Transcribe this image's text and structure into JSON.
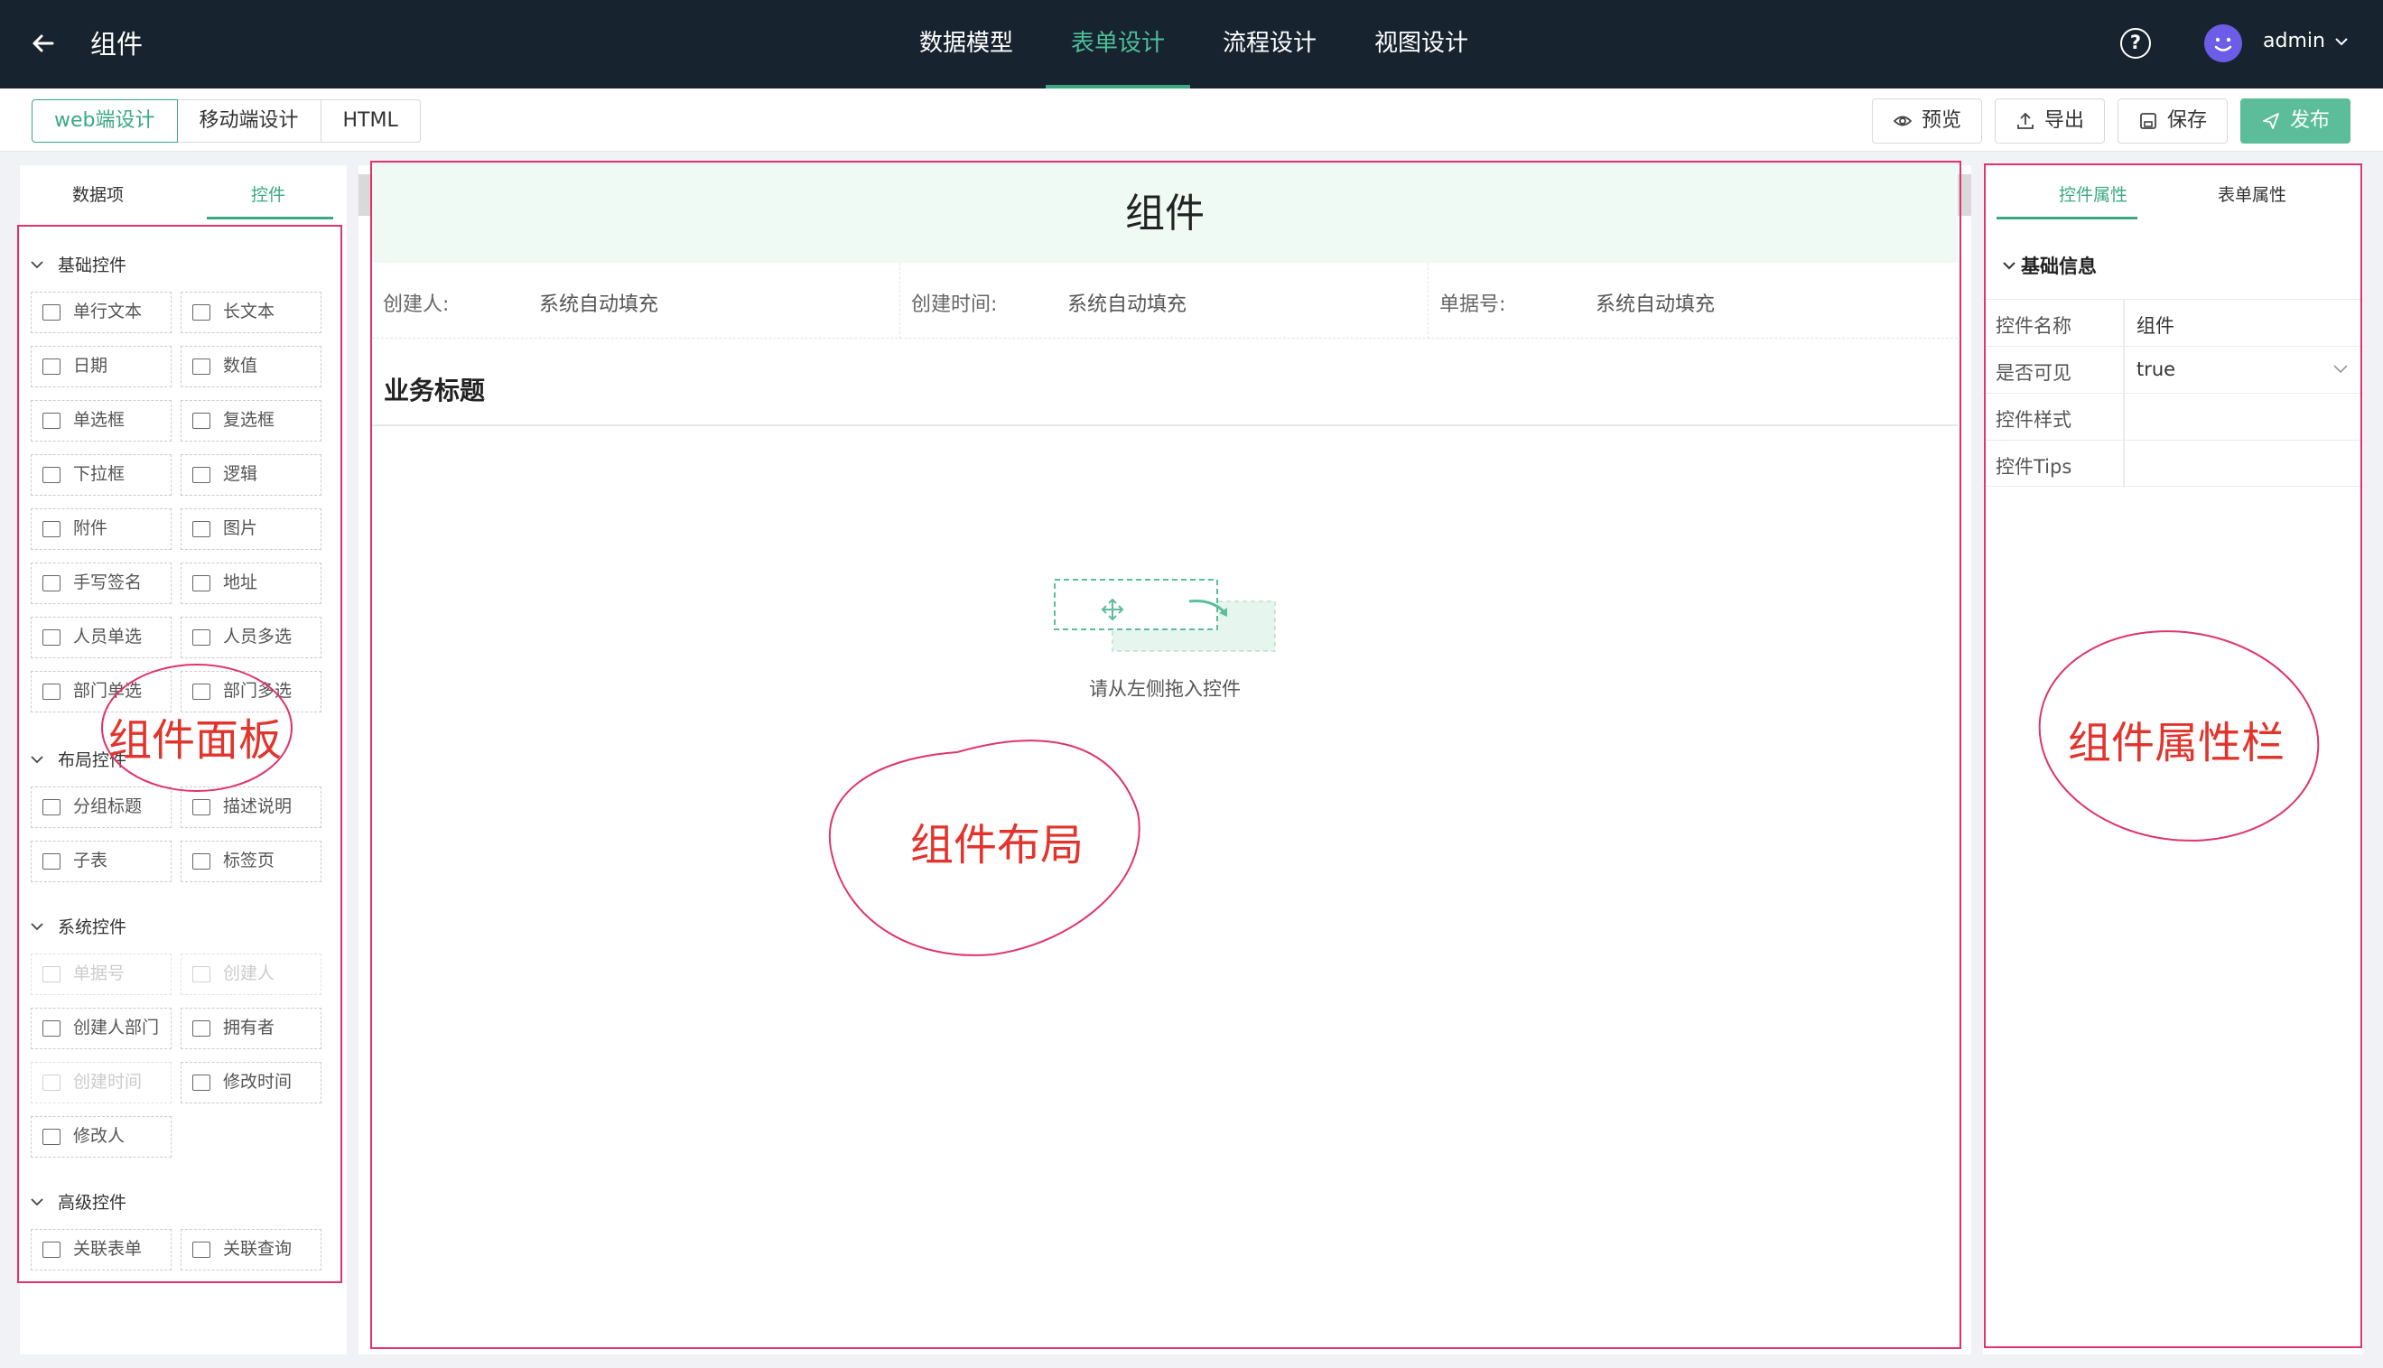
{
  "topbar": {
    "title": "组件",
    "nav": [
      "数据模型",
      "表单设计",
      "流程设计",
      "视图设计"
    ],
    "active_nav": "表单设计",
    "help_glyph": "?",
    "user": "admin",
    "accent_color": "#3aa982",
    "bg_color": "#17232f"
  },
  "subbar": {
    "modes": [
      "web端设计",
      "移动端设计",
      "HTML"
    ],
    "active_mode": "web端设计",
    "actions": {
      "preview": "预览",
      "export": "导出",
      "save": "保存",
      "publish": "发布"
    }
  },
  "left_panel": {
    "tabs": [
      "数据项",
      "控件"
    ],
    "active_tab": "控件",
    "groups": [
      {
        "title": "基础控件",
        "items": [
          {
            "label": "单行文本",
            "icon": "text-input-icon"
          },
          {
            "label": "长文本",
            "icon": "textarea-icon"
          },
          {
            "label": "日期",
            "icon": "calendar-icon"
          },
          {
            "label": "数值",
            "icon": "number-icon"
          },
          {
            "label": "单选框",
            "icon": "radio-icon"
          },
          {
            "label": "复选框",
            "icon": "checkbox-icon"
          },
          {
            "label": "下拉框",
            "icon": "select-icon"
          },
          {
            "label": "逻辑",
            "icon": "toggle-icon"
          },
          {
            "label": "附件",
            "icon": "paperclip-icon"
          },
          {
            "label": "图片",
            "icon": "image-icon"
          },
          {
            "label": "手写签名",
            "icon": "pen-icon"
          },
          {
            "label": "地址",
            "icon": "location-icon"
          },
          {
            "label": "人员单选",
            "icon": "user-icon"
          },
          {
            "label": "人员多选",
            "icon": "users-icon"
          },
          {
            "label": "部门单选",
            "icon": "department-icon"
          },
          {
            "label": "部门多选",
            "icon": "departments-icon"
          }
        ]
      },
      {
        "title": "布局控件",
        "items": [
          {
            "label": "分组标题",
            "icon": "heading-icon"
          },
          {
            "label": "描述说明",
            "icon": "question-icon"
          },
          {
            "label": "子表",
            "icon": "table-icon"
          },
          {
            "label": "标签页",
            "icon": "tabs-icon"
          }
        ]
      },
      {
        "title": "系统控件",
        "items": [
          {
            "label": "单据号",
            "icon": "barcode-icon",
            "disabled": true
          },
          {
            "label": "创建人",
            "icon": "user-icon",
            "disabled": true
          },
          {
            "label": "创建人部门",
            "icon": "org-icon"
          },
          {
            "label": "拥有者",
            "icon": "owner-icon"
          },
          {
            "label": "创建时间",
            "icon": "clock-icon",
            "disabled": true
          },
          {
            "label": "修改时间",
            "icon": "edit-time-icon"
          },
          {
            "label": "修改人",
            "icon": "editor-icon"
          }
        ]
      },
      {
        "title": "高级控件",
        "items": [
          {
            "label": "关联表单",
            "icon": "link-form-icon"
          },
          {
            "label": "关联查询",
            "icon": "link-query-icon"
          }
        ]
      }
    ]
  },
  "canvas": {
    "form_title": "组件",
    "info": [
      {
        "label": "创建人:",
        "value": "系统自动填充"
      },
      {
        "label": "创建时间:",
        "value": "系统自动填充"
      },
      {
        "label": "单据号:",
        "value": "系统自动填充"
      }
    ],
    "business_title": "业务标题",
    "drop_hint": "请从左侧拖入控件"
  },
  "right_panel": {
    "tabs": [
      "控件属性",
      "表单属性"
    ],
    "active_tab": "控件属性",
    "section": "基础信息",
    "props": [
      {
        "key": "控件名称",
        "value": "组件"
      },
      {
        "key": "是否可见",
        "value": "true",
        "dropdown": true
      },
      {
        "key": "控件样式",
        "value": ""
      },
      {
        "key": "控件Tips",
        "value": ""
      }
    ]
  },
  "annotations": [
    "组件面板",
    "组件布局",
    "组件属性栏"
  ]
}
